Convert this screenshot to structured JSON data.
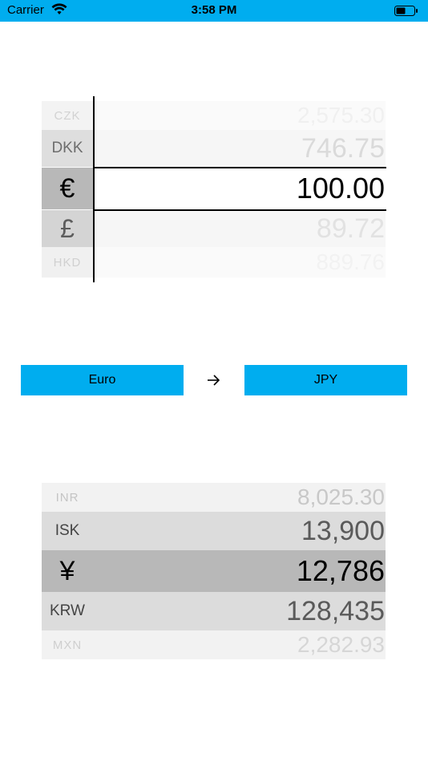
{
  "status": {
    "carrier": "Carrier",
    "time": "3:58 PM"
  },
  "top_picker": {
    "rows": [
      {
        "code": "CZK",
        "value": "2,575.30"
      },
      {
        "code": "DKK",
        "value": "746.75"
      },
      {
        "code": "€",
        "value": "100.00"
      },
      {
        "code": "£",
        "value": "89.72"
      },
      {
        "code": "HKD",
        "value": "889.76"
      }
    ]
  },
  "buttons": {
    "from": "Euro",
    "to": "JPY"
  },
  "bottom_picker": {
    "rows": [
      {
        "code": "INR",
        "value": "8,025.30"
      },
      {
        "code": "ISK",
        "value": "13,900"
      },
      {
        "code": "¥",
        "value": "12,786"
      },
      {
        "code": "KRW",
        "value": "128,435"
      },
      {
        "code": "MXN",
        "value": "2,282.93"
      }
    ]
  },
  "colors": {
    "accent": "#00adef"
  },
  "icons": {
    "wifi": "wifi-icon",
    "battery": "battery-icon",
    "arrow": "arrow-right-icon"
  }
}
